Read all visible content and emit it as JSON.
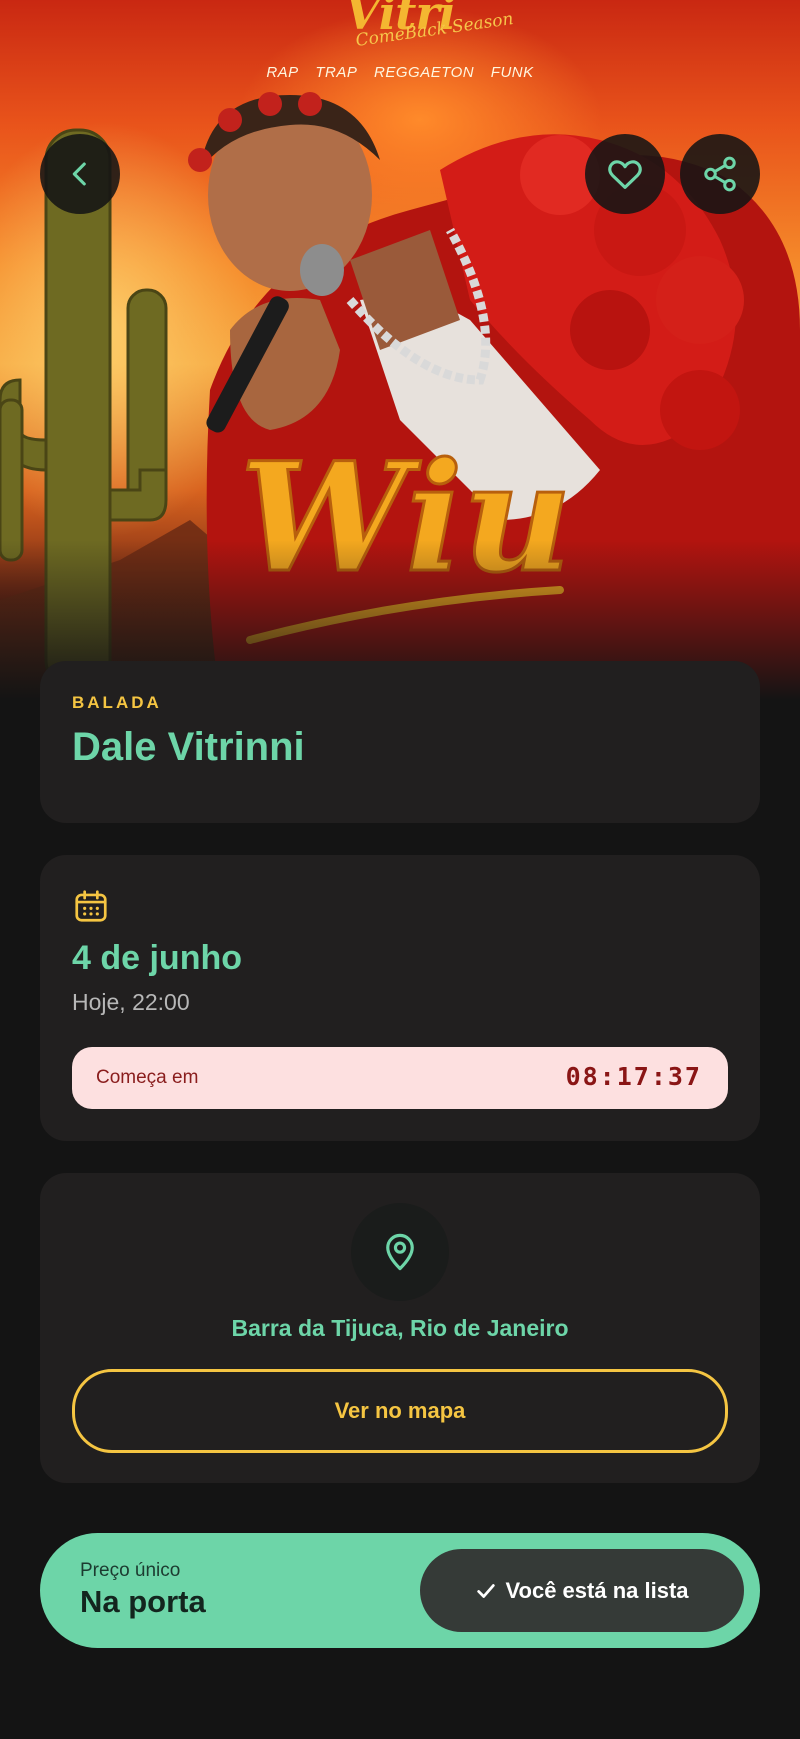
{
  "hero": {
    "artist_logo": "Wiu",
    "event_logo": "Vitri",
    "event_subtitle": "ComeBack Season",
    "genres": [
      "RAP",
      "TRAP",
      "REGGAETON",
      "FUNK"
    ],
    "back_icon": "chevron-left-icon",
    "favorite_icon": "heart-icon",
    "share_icon": "share-icon"
  },
  "event": {
    "category": "BALADA",
    "name": "Dale Vitrinni"
  },
  "schedule": {
    "icon": "calendar-icon",
    "date": "4 de junho",
    "time": "Hoje, 22:00",
    "countdown_label": "Começa em",
    "countdown_value": "08:17:37"
  },
  "venue": {
    "icon": "map-pin-icon",
    "location": "Barra da Tijuca, Rio de Janeiro",
    "map_button": "Ver no mapa"
  },
  "footer": {
    "price_label": "Preço único",
    "price_value": "Na porta",
    "check_icon": "check-icon",
    "status_button": "Você está na lista"
  },
  "colors": {
    "background": "#141414",
    "card": "#211f1f",
    "accent_green": "#6dd5a8",
    "accent_yellow": "#f5c542",
    "countdown_bg": "#fde0e0",
    "countdown_text": "#8a1515"
  }
}
